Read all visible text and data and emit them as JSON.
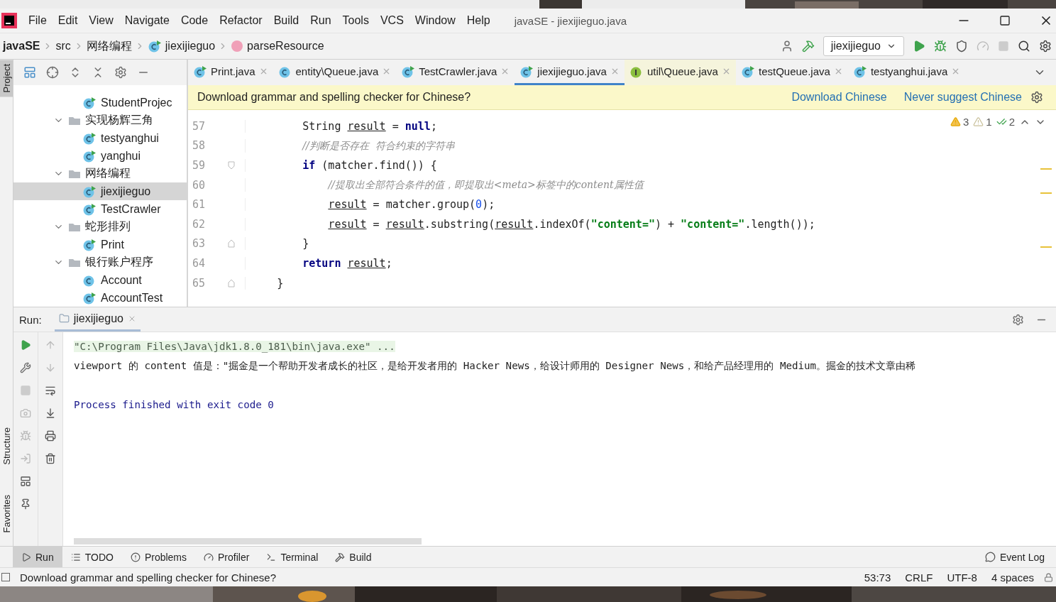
{
  "window": {
    "title": "javaSE - jiexijieguo.java"
  },
  "menu": [
    "File",
    "Edit",
    "View",
    "Navigate",
    "Code",
    "Refactor",
    "Build",
    "Run",
    "Tools",
    "VCS",
    "Window",
    "Help"
  ],
  "breadcrumbs": [
    {
      "label": "javaSE",
      "kind": "project"
    },
    {
      "label": "src",
      "kind": "folder"
    },
    {
      "label": "网络编程",
      "kind": "folder"
    },
    {
      "label": "jiexijieguo",
      "kind": "class"
    },
    {
      "label": "parseResource",
      "kind": "method"
    }
  ],
  "run_config": {
    "label": "jiexijieguo"
  },
  "side_strip": [
    {
      "label": "Project",
      "selected": true
    },
    {
      "label": "Structure",
      "selected": false
    },
    {
      "label": "Favorites",
      "selected": false
    }
  ],
  "project_tree": [
    {
      "label": "StudentProjec",
      "kind": "class",
      "runnable": true,
      "selected": false
    },
    {
      "label": "实现杨辉三角",
      "kind": "folder",
      "expanded": true,
      "selected": false,
      "children": [
        {
          "label": "testyanghui",
          "kind": "class",
          "runnable": true,
          "selected": false
        },
        {
          "label": "yanghui",
          "kind": "class",
          "runnable": true,
          "selected": false
        }
      ]
    },
    {
      "label": "网络编程",
      "kind": "folder",
      "expanded": true,
      "selected": false,
      "children": [
        {
          "label": "jiexijieguo",
          "kind": "class",
          "runnable": true,
          "selected": true
        },
        {
          "label": "TestCrawler",
          "kind": "class",
          "runnable": true,
          "selected": false
        }
      ]
    },
    {
      "label": "蛇形排列",
      "kind": "folder",
      "expanded": true,
      "selected": false,
      "children": [
        {
          "label": "Print",
          "kind": "class",
          "runnable": true,
          "selected": false
        }
      ]
    },
    {
      "label": "银行账户程序",
      "kind": "folder",
      "expanded": true,
      "selected": false,
      "children": [
        {
          "label": "Account",
          "kind": "class",
          "runnable": false,
          "selected": false
        },
        {
          "label": "AccountTest",
          "kind": "class",
          "runnable": true,
          "selected": false
        }
      ]
    }
  ],
  "editor_tabs": [
    {
      "label": "Print.java",
      "kind": "class",
      "runnable": true,
      "selected": false
    },
    {
      "label": "entity\\Queue.java",
      "kind": "class",
      "runnable": false,
      "selected": false
    },
    {
      "label": "TestCrawler.java",
      "kind": "class",
      "runnable": true,
      "selected": false
    },
    {
      "label": "jiexijieguo.java",
      "kind": "class",
      "runnable": true,
      "selected": true
    },
    {
      "label": "util\\Queue.java",
      "kind": "interface",
      "runnable": false,
      "selected": false
    },
    {
      "label": "testQueue.java",
      "kind": "class",
      "runnable": true,
      "selected": false
    },
    {
      "label": "testyanghui.java",
      "kind": "class",
      "runnable": true,
      "selected": false
    }
  ],
  "banner": {
    "message": "Download grammar and spelling checker for Chinese?",
    "actions": [
      "Download Chinese",
      "Never suggest Chinese"
    ]
  },
  "inspections": [
    {
      "kind": "warning",
      "count": "3"
    },
    {
      "kind": "weak",
      "count": "1"
    },
    {
      "kind": "typo",
      "count": "2"
    }
  ],
  "code": [
    {
      "number": "57",
      "kind": "plain",
      "tokens": [
        {
          "kind": "plain",
          "text": "        String "
        },
        {
          "kind": "var",
          "text": "result"
        },
        {
          "kind": "plain",
          "text": " = "
        },
        {
          "kind": "keyword",
          "text": "null"
        },
        {
          "kind": "plain",
          "text": ";"
        }
      ]
    },
    {
      "number": "58",
      "kind": "plain",
      "tokens": [
        {
          "kind": "comment",
          "text": "        //判断是否存在  符合约束的字符串"
        }
      ]
    },
    {
      "number": "59",
      "kind": "fold_open",
      "tokens": [
        {
          "kind": "keyword",
          "text": "        if"
        },
        {
          "kind": "plain",
          "text": " (matcher.find()) {"
        }
      ]
    },
    {
      "number": "60",
      "kind": "plain",
      "tokens": [
        {
          "kind": "comment",
          "text": "            //提取出全部符合条件的值，即提取出<meta>标签中的content属性值"
        }
      ]
    },
    {
      "number": "61",
      "kind": "plain",
      "tokens": [
        {
          "kind": "var",
          "text": "            result"
        },
        {
          "kind": "plain",
          "text": " = matcher.group("
        },
        {
          "kind": "number",
          "text": "0"
        },
        {
          "kind": "plain",
          "text": ");"
        }
      ]
    },
    {
      "number": "62",
      "kind": "plain",
      "tokens": [
        {
          "kind": "var",
          "text": "            result"
        },
        {
          "kind": "plain",
          "text": " = "
        },
        {
          "kind": "var",
          "text": "result"
        },
        {
          "kind": "plain",
          "text": ".substring("
        },
        {
          "kind": "var",
          "text": "result"
        },
        {
          "kind": "plain",
          "text": ".indexOf("
        },
        {
          "kind": "string",
          "text": "\"content=\""
        },
        {
          "kind": "plain",
          "text": ") + "
        },
        {
          "kind": "string",
          "text": "\"content=\""
        },
        {
          "kind": "plain",
          "text": ".length());"
        }
      ]
    },
    {
      "number": "63",
      "kind": "fold_close",
      "tokens": [
        {
          "kind": "plain",
          "text": "        }"
        }
      ]
    },
    {
      "number": "64",
      "kind": "plain",
      "tokens": [
        {
          "kind": "keyword",
          "text": "        return"
        },
        {
          "kind": "var",
          "text": " result"
        },
        {
          "kind": "plain",
          "text": ";"
        }
      ]
    },
    {
      "number": "65",
      "kind": "fold_close",
      "tokens": [
        {
          "kind": "plain",
          "text": "    }"
        }
      ]
    }
  ],
  "run_panel": {
    "label": "Run:",
    "tab": "jiexijieguo",
    "console": [
      {
        "kind": "command",
        "text": "\"C:\\Program Files\\Java\\jdk1.8.0_181\\bin\\java.exe\" ..."
      },
      {
        "kind": "output",
        "text": "viewport 的 content 值是：\"掘金是一个帮助开发者成长的社区，是给开发者用的 Hacker News，给设计师用的 Designer News，和给产品经理用的 Medium。掘金的技术文章由稀"
      },
      {
        "kind": "blank"
      },
      {
        "kind": "exit",
        "text": "Process finished with exit code 0"
      }
    ]
  },
  "tool_windows": [
    {
      "label": "Run",
      "kind": "run",
      "selected": true
    },
    {
      "label": "TODO",
      "kind": "todo",
      "selected": false
    },
    {
      "label": "Problems",
      "kind": "problems",
      "selected": false
    },
    {
      "label": "Profiler",
      "kind": "profiler",
      "selected": false
    },
    {
      "label": "Terminal",
      "kind": "terminal",
      "selected": false
    },
    {
      "label": "Build",
      "kind": "build",
      "selected": false
    }
  ],
  "event_log": "Event Log",
  "status_bar": {
    "message": "Download grammar and spelling checker for Chinese?",
    "items": [
      "53:73",
      "CRLF",
      "UTF-8",
      "4 spaces"
    ]
  }
}
